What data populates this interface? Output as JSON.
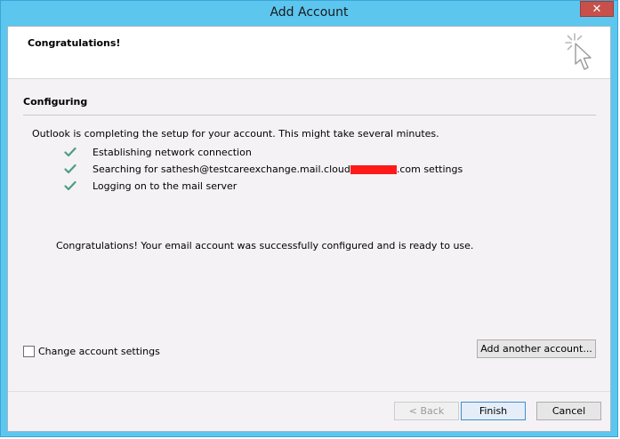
{
  "window": {
    "title": "Add Account",
    "close_label": "✕"
  },
  "header": {
    "title": "Congratulations!"
  },
  "section": {
    "title": "Configuring",
    "intro": "Outlook is completing the setup for your account. This might take several minutes.",
    "steps": [
      {
        "label": "Establishing network connection"
      },
      {
        "label_before": "Searching for sathesh@testcareexchange.mail.cloud",
        "label_after": ".com settings"
      },
      {
        "label": "Logging on to the mail server"
      }
    ],
    "success": "Congratulations! Your email account was successfully configured and is ready to use."
  },
  "options": {
    "change_settings_label": "Change account settings",
    "change_settings_checked": false
  },
  "buttons": {
    "add_another": "Add another account...",
    "back": "< Back",
    "finish": "Finish",
    "cancel": "Cancel"
  },
  "colors": {
    "check": "#4e9a8a",
    "redaction": "#ff1a1a",
    "titlebar": "#5cc6ef"
  },
  "icons": {
    "header_icon": "cursor-click-icon",
    "step_icon": "checkmark-icon"
  }
}
